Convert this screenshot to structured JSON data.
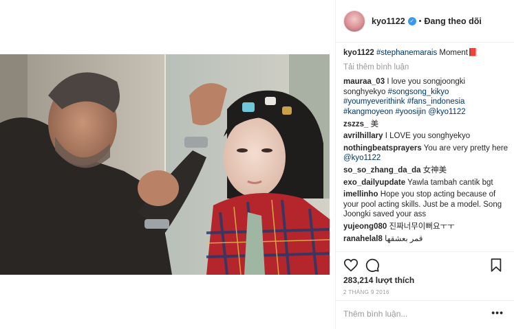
{
  "header": {
    "username": "kyo1122",
    "separator": "•",
    "follow_status": "Đang theo dõi"
  },
  "caption": {
    "username": "kyo1122",
    "hashtag": "#stephanemarais",
    "text": "Moment",
    "emoji": "📕"
  },
  "load_more": "Tải thêm bình luận",
  "comments": [
    {
      "user": "mauraa_03",
      "parts": [
        {
          "t": "I love you songjoongki songhyekyo "
        },
        {
          "tag": "#songsong_kikyo"
        },
        {
          "t": " "
        },
        {
          "tag": "#youmyeverithink"
        },
        {
          "t": " "
        },
        {
          "tag": "#fans_indonesia"
        },
        {
          "t": " "
        },
        {
          "tag": "#kangmoyeon"
        },
        {
          "t": " "
        },
        {
          "tag": "#yoosijin"
        },
        {
          "t": " "
        },
        {
          "tag": "@kyo1122"
        }
      ]
    },
    {
      "user": "zszzs_",
      "parts": [
        {
          "t": "美"
        }
      ]
    },
    {
      "user": "avrilhillary",
      "parts": [
        {
          "t": "I LOVE you songhyekyo"
        }
      ]
    },
    {
      "user": "nothingbeatsprayers",
      "parts": [
        {
          "t": "You are very pretty here "
        },
        {
          "tag": "@kyo1122"
        }
      ]
    },
    {
      "user": "so_so_zhang_da_da",
      "parts": [
        {
          "t": "女神美"
        }
      ]
    },
    {
      "user": "exo_dailyupdate",
      "parts": [
        {
          "t": "Yawla tambah cantik bgt"
        }
      ]
    },
    {
      "user": "imellinho",
      "parts": [
        {
          "t": "Hope you stop acting because of your pool acting skills. Just be a model. Song Joongki saved your ass"
        }
      ]
    },
    {
      "user": "yujeong080",
      "parts": [
        {
          "t": "진짜너무이뻐요ㅜㅜ"
        }
      ]
    },
    {
      "user": "ranahelal8",
      "parts": [
        {
          "t": "قمر بعشقها"
        }
      ]
    }
  ],
  "actions": {
    "like_icon": "heart-icon",
    "comment_icon": "comment-bubble-icon",
    "save_icon": "bookmark-icon"
  },
  "likes": "283,214 lượt thích",
  "date": "2 THÁNG 9 2016",
  "add_comment": {
    "placeholder": "Thêm bình luận...",
    "more": "•••"
  },
  "colors": {
    "link": "#003569",
    "verified": "#3897f0",
    "muted": "#999999",
    "border": "#efefef"
  }
}
